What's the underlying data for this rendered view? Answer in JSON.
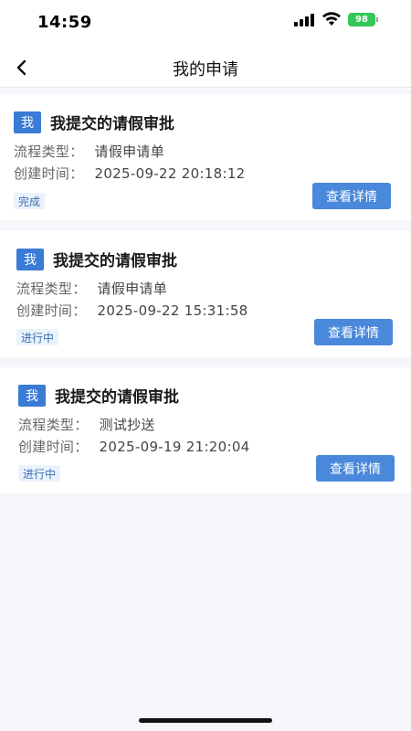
{
  "status_bar": {
    "time": "14:59",
    "battery": "98"
  },
  "nav": {
    "title": "我的申请"
  },
  "labels": {
    "process_type": "流程类型：",
    "created_time": "创建时间：",
    "detail_button": "查看详情"
  },
  "applications": [
    {
      "avatar": "我",
      "title": "我提交的请假审批",
      "process_type": "请假申请单",
      "created_time": "2025-09-22 20:18:12",
      "status": "完成"
    },
    {
      "avatar": "我",
      "title": "我提交的请假审批",
      "process_type": "请假申请单",
      "created_time": "2025-09-22 15:31:58",
      "status": "进行中"
    },
    {
      "avatar": "我",
      "title": "我提交的请假审批",
      "process_type": "测试抄送",
      "created_time": "2025-09-19 21:20:04",
      "status": "进行中"
    }
  ],
  "colors": {
    "accent": "#4a88db",
    "avatar_bg": "#3a7bd5",
    "tag_bg": "#eaf2fc",
    "tag_text": "#3a6fb0",
    "battery": "#34c759"
  }
}
